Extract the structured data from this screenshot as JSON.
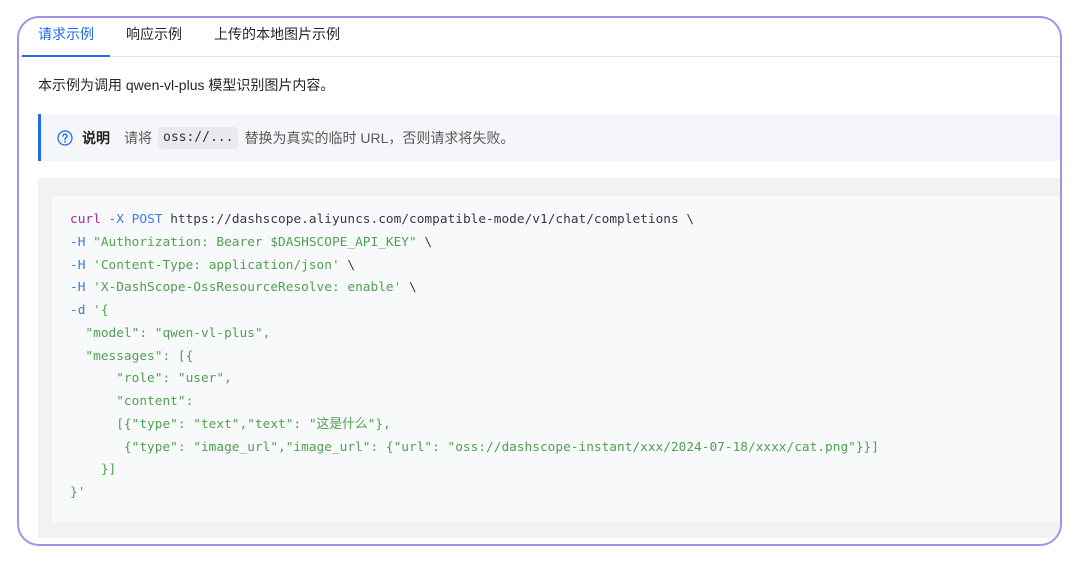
{
  "tabs": {
    "items": [
      {
        "label": "请求示例",
        "active": true
      },
      {
        "label": "响应示例",
        "active": false
      },
      {
        "label": "上传的本地图片示例",
        "active": false
      }
    ]
  },
  "description": "本示例为调用 qwen-vl-plus 模型识别图片内容。",
  "note": {
    "icon": "question-circle-icon",
    "title": "说明",
    "text_before": "请将",
    "inline_code": "oss://...",
    "text_after": "替换为真实的临时 URL，否则请求将失败。"
  },
  "code": {
    "lines": [
      [
        {
          "text": "curl",
          "color": "#a626a4"
        },
        {
          "text": " -X",
          "color": "#3a7bd5"
        },
        {
          "text": " POST",
          "color": "#4078f2"
        },
        {
          "text": " https://dashscope.aliyuncs.com/compatible-mode/v1/chat/completions \\",
          "color": "#383a42"
        }
      ],
      [
        {
          "text": "-H",
          "color": "#3a7bd5"
        },
        {
          "text": " \"Authorization: Bearer $DASHSCOPE_API_KEY\"",
          "color": "#50a14f"
        },
        {
          "text": " \\",
          "color": "#383a42"
        }
      ],
      [
        {
          "text": "-H",
          "color": "#3a7bd5"
        },
        {
          "text": " 'Content-Type: application/json'",
          "color": "#50a14f"
        },
        {
          "text": " \\",
          "color": "#383a42"
        }
      ],
      [
        {
          "text": "-H",
          "color": "#3a7bd5"
        },
        {
          "text": " 'X-DashScope-OssResourceResolve: enable'",
          "color": "#50a14f"
        },
        {
          "text": " \\",
          "color": "#383a42"
        }
      ],
      [
        {
          "text": "-d",
          "color": "#3a7bd5"
        },
        {
          "text": " '{",
          "color": "#50a14f"
        }
      ],
      [
        {
          "text": "  \"model\": \"qwen-vl-plus\",",
          "color": "#50a14f"
        }
      ],
      [
        {
          "text": "  \"messages\": [{",
          "color": "#50a14f"
        }
      ],
      [
        {
          "text": "      \"role\": \"user\",",
          "color": "#50a14f"
        }
      ],
      [
        {
          "text": "      \"content\":",
          "color": "#50a14f"
        }
      ],
      [
        {
          "text": "      [{\"type\": \"text\",\"text\": \"这是什么\"},",
          "color": "#50a14f"
        }
      ],
      [
        {
          "text": "       {\"type\": \"image_url\",\"image_url\": {\"url\": \"oss://dashscope-instant/xxx/2024-07-18/xxxx/cat.png\"}}]",
          "color": "#50a14f"
        }
      ],
      [
        {
          "text": "    }]",
          "color": "#50a14f"
        }
      ],
      [
        {
          "text": "}'",
          "color": "#50a14f"
        }
      ]
    ]
  },
  "colors": {
    "accent": "#1f6aef",
    "frame_border": "#a690e8",
    "text_primary": "#262626",
    "text_secondary": "#595959"
  }
}
